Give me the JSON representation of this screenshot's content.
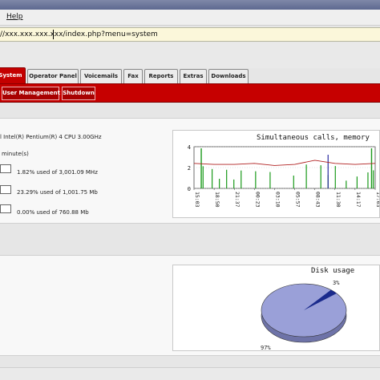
{
  "menu": {
    "help_label": "Help"
  },
  "address": {
    "url": "//xxx.xxx.xxx.xxx/index.php?menu=system"
  },
  "tabs": [
    {
      "label": "System",
      "active": true
    },
    {
      "label": "Operator Panel",
      "active": false
    },
    {
      "label": "Voicemails",
      "active": false
    },
    {
      "label": "Fax",
      "active": false
    },
    {
      "label": "Reports",
      "active": false
    },
    {
      "label": "Extras",
      "active": false
    },
    {
      "label": "Downloads",
      "active": false
    }
  ],
  "subtabs": [
    {
      "label": "User Management"
    },
    {
      "label": "Shutdown"
    }
  ],
  "system_info": {
    "cpu_info": "l Intel(R) Pentium(R) 4 CPU 3.00GHz",
    "uptime": "minute(s)",
    "cpu_usage": "1.82% used of 3,001.09 MHz",
    "memory_usage": "23.29% used of 1,001.75 Mb",
    "swap_usage": "0.00% used of 760.88 Mb"
  },
  "calls_chart": {
    "title": "Simultaneous calls, memory",
    "y_ticks": [
      "4",
      "2",
      "0"
    ],
    "x_ticks": [
      "15:03",
      "18:50",
      "21:37",
      "00:23",
      "03:10",
      "05:57",
      "08:43",
      "11:30",
      "14:17",
      "17:03"
    ]
  },
  "disk_chart": {
    "title": "Disk usage",
    "slice_labels": [
      "3%",
      "97%"
    ]
  },
  "colors": {
    "accent_red": "#c60000",
    "pie_fill": "#9aa0d8",
    "pie_slice": "#1a2a8c"
  },
  "chart_data": [
    {
      "type": "line",
      "title": "Simultaneous calls, memory",
      "x": [
        "15:03",
        "18:50",
        "21:37",
        "00:23",
        "03:10",
        "05:57",
        "08:43",
        "11:30",
        "14:17",
        "17:03"
      ],
      "series": [
        {
          "values": [
            2.4,
            2.3,
            2.3,
            2.4,
            2.2,
            2.3,
            2.7,
            2.4,
            2.3,
            2.4
          ]
        }
      ],
      "ylim": [
        0,
        4
      ]
    },
    {
      "type": "pie",
      "title": "Disk usage",
      "labels": [
        "3%",
        "97%"
      ],
      "values": [
        3,
        97
      ]
    }
  ]
}
